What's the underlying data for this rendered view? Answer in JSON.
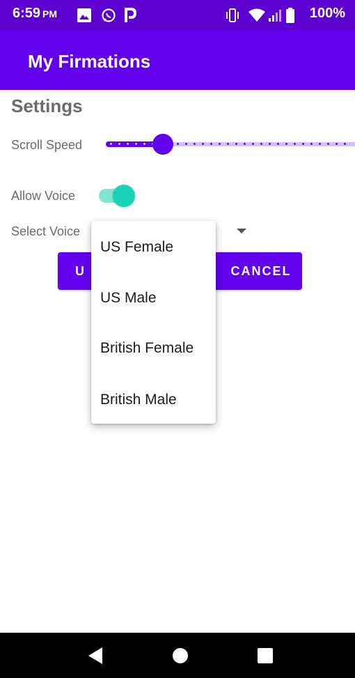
{
  "status_bar": {
    "time": "6:59",
    "ampm": "PM",
    "battery": "100%",
    "icons": [
      "image-icon",
      "whatsapp-icon",
      "parking-app-icon",
      "vibrate-icon",
      "wifi-icon",
      "signal-icon",
      "battery-icon"
    ]
  },
  "app_bar": {
    "title": "My Firmations"
  },
  "settings": {
    "title": "Settings",
    "scroll_speed_label": "Scroll Speed",
    "scroll_speed_fraction": 0.2,
    "allow_voice_label": "Allow Voice",
    "allow_voice_on": true,
    "select_voice_label": "Select Voice",
    "update_label": "UPDATE",
    "update_visible_label": "U",
    "cancel_label": "CANCEL"
  },
  "voice_dropdown": {
    "options": [
      "US Female",
      "US Male",
      "British Female",
      "British Male"
    ]
  },
  "colors": {
    "status_bar": "#5b00cf",
    "primary": "#6200ee",
    "accent": "#18d3b5",
    "slider_inactive": "#d6c0fb"
  },
  "nav_bar": {
    "icons": [
      "back-icon",
      "home-icon",
      "recents-icon"
    ]
  }
}
